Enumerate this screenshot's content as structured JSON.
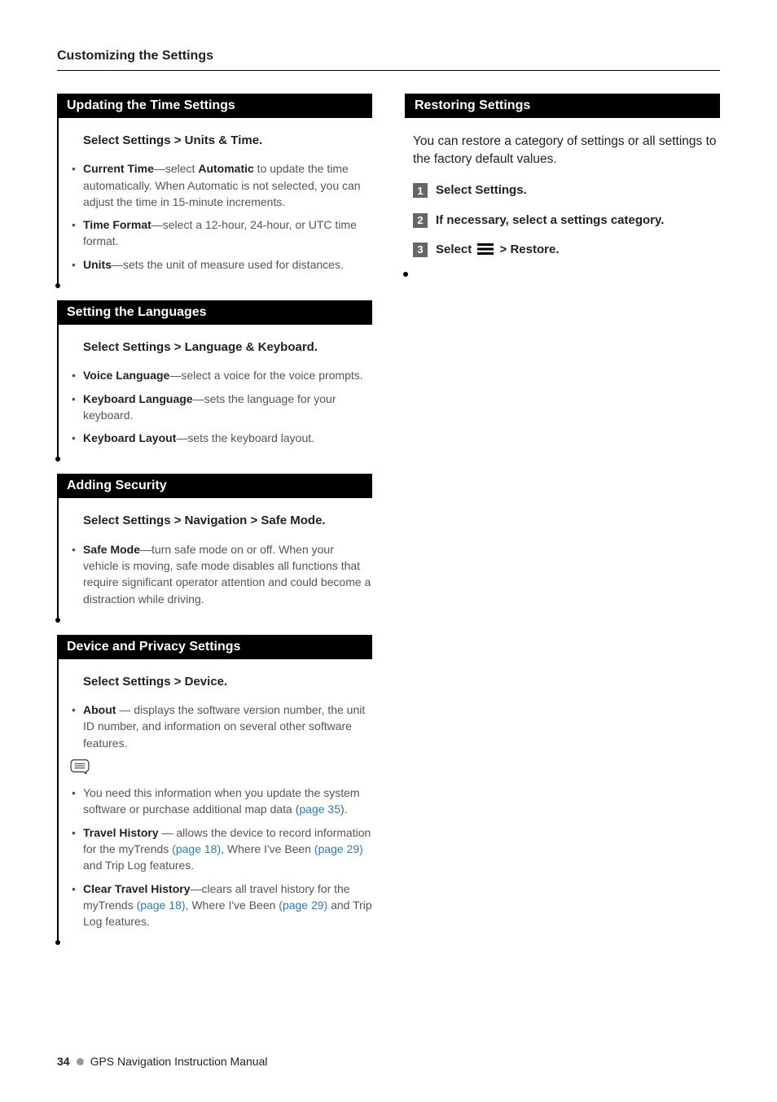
{
  "header": "Customizing the Settings",
  "left": {
    "s1": {
      "title": "Updating the Time Settings",
      "instruction": "Select Settings > Units & Time.",
      "b1_term": "Current Time",
      "b1_mid": "—select ",
      "b1_bold": "Automatic",
      "b1_rest": " to update the time automatically. When Automatic is not selected, you can adjust the time in 15-minute increments.",
      "b2_term": "Time Format",
      "b2_rest": "—select a 12-hour, 24-hour, or UTC time format.",
      "b3_term": "Units",
      "b3_rest": "—sets the unit of measure used for distances."
    },
    "s2": {
      "title": "Setting the Languages",
      "instruction": "Select Settings > Language & Keyboard.",
      "b1_term": "Voice Language",
      "b1_rest": "—select a voice for the voice prompts.",
      "b2_term": "Keyboard Language",
      "b2_rest": "—sets the language for your keyboard.",
      "b3_term": "Keyboard Layout",
      "b3_rest": "—sets the keyboard layout."
    },
    "s3": {
      "title": "Adding Security",
      "instruction": "Select Settings > Navigation > Safe Mode.",
      "b1_term": "Safe Mode",
      "b1_rest": "—turn safe mode on or off. When your vehicle is moving, safe mode disables all functions that require significant operator attention and could become a distraction while driving."
    },
    "s4": {
      "title": "Device and Privacy Settings",
      "instruction": "Select Settings > Device.",
      "b1_term": "About",
      "b1_rest": " — displays the software version number, the unit ID number, and information on several other software features.",
      "note_pre": "You need this information when you update the system software or purchase additional map data (",
      "note_link": "page 35",
      "note_post": ").",
      "b2_term": "Travel History",
      "b2_a": " — allows the device to record information for the myTrends ",
      "b2_l1": "(page 18)",
      "b2_b": ", Where I've Been ",
      "b2_l2": "(page 29)",
      "b2_c": " and Trip Log features.",
      "b3_term": "Clear Travel History",
      "b3_a": "—clears all travel history for the myTrends ",
      "b3_l1": "(page 18)",
      "b3_b": ", Where I've Been ",
      "b3_l2": "(page 29)",
      "b3_c": " and Trip Log features."
    }
  },
  "right": {
    "s1": {
      "title": "Restoring Settings",
      "intro": "You can restore a category of settings or all settings to the factory default values.",
      "step1": "Select Settings.",
      "step2": "If necessary, select a settings category.",
      "step3a": "Select ",
      "step3b": " > Restore."
    }
  },
  "footer": {
    "page": "34",
    "title": "GPS Navigation Instruction Manual"
  }
}
